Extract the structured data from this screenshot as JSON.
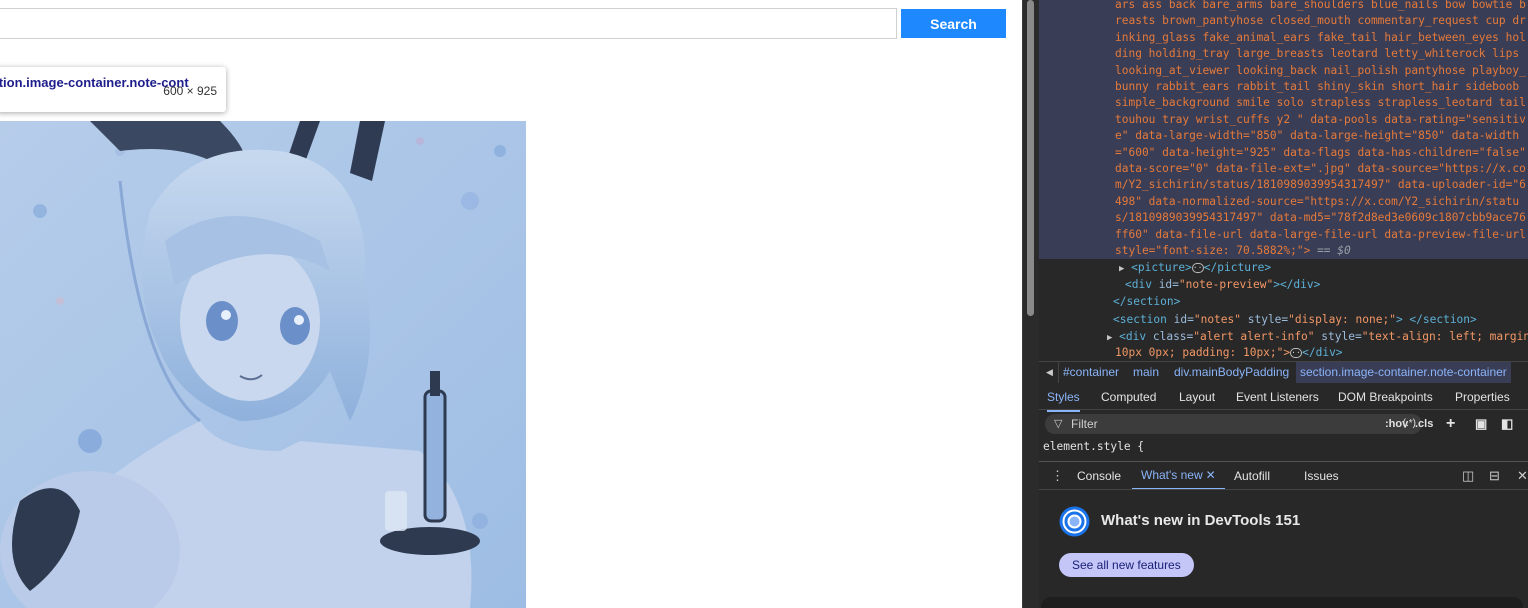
{
  "page": {
    "search_placeholder": "",
    "search_label": "Search",
    "tooltip_selector": "section.image-container.note-cont",
    "tooltip_dims": "600 × 925"
  },
  "devtools": {
    "selected_code": "ars ass back bare_arms bare_shoulders blue_nails bow bowtie breasts brown_pantyhose closed_mouth commentary_request cup drinking_glass fake_animal_ears fake_tail hair_between_eyes holding holding_tray large_breasts leotard letty_whiterock lips looking_at_viewer looking_back nail_polish pantyhose playboy_bunny rabbit_ears rabbit_tail shiny_skin short_hair sideboob simple_background smile solo strapless strapless_leotard tail touhou tray wrist_cuffs y2 \" data-pools data-rating=\"sensitive\" data-large-width=\"850\" data-large-height=\"850\" data-width=\"600\" data-height=\"925\" data-flags data-has-children=\"false\" data-score=\"0\" data-file-ext=\".jpg\" data-source=\"https://x.com/Y2_sichirin/status/1810989039954317497\" data-uploader-id=\"6498\" data-normalized-source=\"https://x.com/Y2_sichirin/status/1810989039954317497\" data-md5=\"78f2d8ed3e0609c1807cbb9ace76ff60\" data-file-url data-large-file-url data-preview-file-url style=\"font-size: 70.5882%;\">",
    "selected_suffix": " == $0",
    "tree": {
      "picture_open": "<picture>",
      "picture_close": "</picture>",
      "div_open": "<div ",
      "div_id_attr": "id=",
      "div_id_val": "\"note-preview\"",
      "div_close": "></div>",
      "section_close": "</section>",
      "notes_open": "<section ",
      "notes_id_attr": "id=",
      "notes_id_val": "\"notes\"",
      "notes_style_attr": " style=",
      "notes_style_val": "\"display: none;\"",
      "notes_close": "> </section>",
      "alert_open": "<div ",
      "alert_class_attr": "class=",
      "alert_class_val": "\"alert alert-info\"",
      "alert_style_attr": " style=",
      "alert_style_val": "\"text-align: left; margin:",
      "alert_line2": "10px 0px; padding: 10px;\">",
      "alert_close": "</div>"
    },
    "breadcrumbs": [
      "#container",
      "main",
      "div.mainBodyPadding",
      "section.image-container.note-container"
    ],
    "panel_tabs": [
      "Styles",
      "Computed",
      "Layout",
      "Event Listeners",
      "DOM Breakpoints",
      "Properties"
    ],
    "filter_placeholder": "Filter",
    "filter_regex": "(.*)",
    "hov_label": ":hov",
    "cls_label": ".cls",
    "element_style": "element.style {",
    "drawer_tabs": [
      "Console",
      "What's new",
      "Autofill",
      "Issues"
    ],
    "whats_new_title": "What's new in DevTools 151",
    "whats_new_button": "See all new features"
  }
}
